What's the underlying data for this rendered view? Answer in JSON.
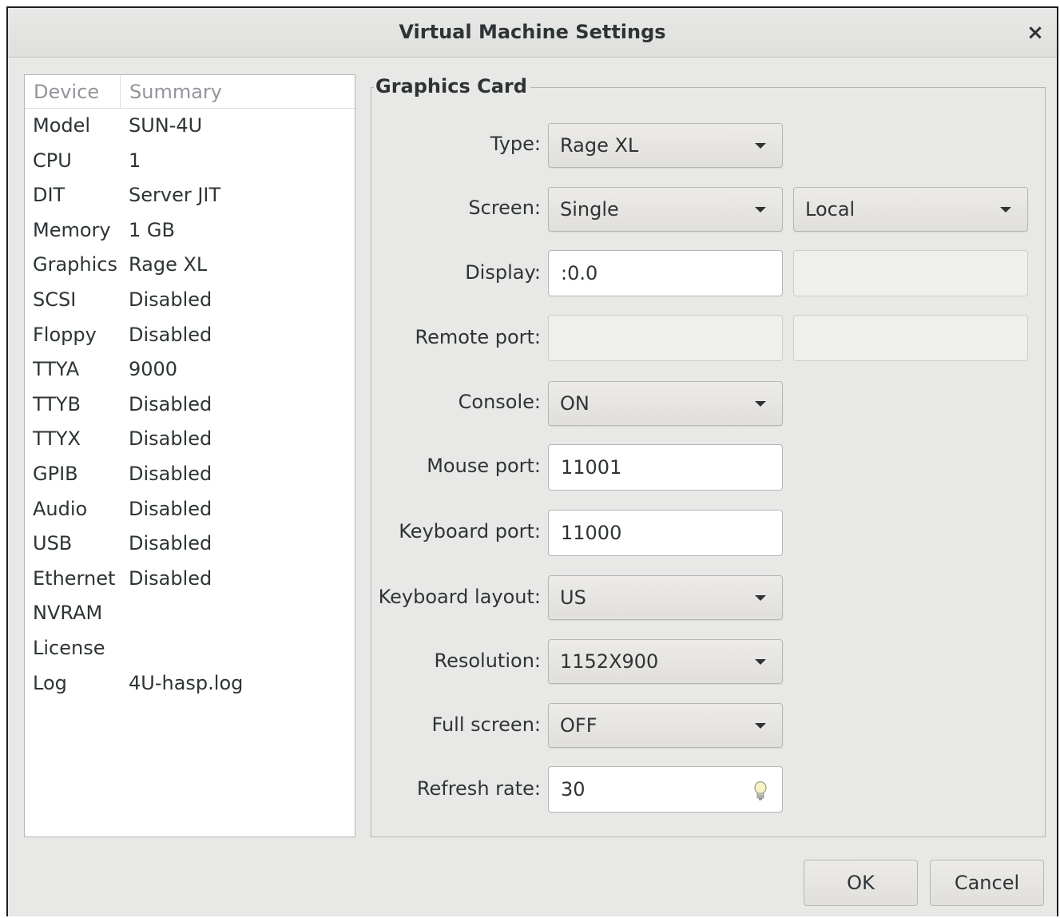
{
  "window": {
    "title": "Virtual Machine Settings",
    "close_glyph": "×"
  },
  "device_list": {
    "headers": {
      "device": "Device",
      "summary": "Summary"
    },
    "rows": [
      {
        "device": "Model",
        "summary": "SUN-4U"
      },
      {
        "device": "CPU",
        "summary": "1"
      },
      {
        "device": "DIT",
        "summary": "Server JIT"
      },
      {
        "device": "Memory",
        "summary": "1 GB"
      },
      {
        "device": "Graphics",
        "summary": "Rage XL"
      },
      {
        "device": "SCSI",
        "summary": "Disabled"
      },
      {
        "device": "Floppy",
        "summary": "Disabled"
      },
      {
        "device": "TTYA",
        "summary": "9000"
      },
      {
        "device": "TTYB",
        "summary": "Disabled"
      },
      {
        "device": "TTYX",
        "summary": "Disabled"
      },
      {
        "device": "GPIB",
        "summary": "Disabled"
      },
      {
        "device": "Audio",
        "summary": "Disabled"
      },
      {
        "device": "USB",
        "summary": "Disabled"
      },
      {
        "device": "Ethernet",
        "summary": "Disabled"
      },
      {
        "device": "NVRAM",
        "summary": ""
      },
      {
        "device": "License",
        "summary": ""
      },
      {
        "device": "Log",
        "summary": "4U-hasp.log"
      }
    ]
  },
  "graphics": {
    "frame_title": "Graphics Card",
    "type": {
      "label": "Type:",
      "value": "Rage XL"
    },
    "screen": {
      "label": "Screen:",
      "value": "Single",
      "secondary_value": "Local"
    },
    "display": {
      "label": "Display:",
      "value": ":0.0",
      "secondary_value": ""
    },
    "remote_port": {
      "label": "Remote port:",
      "value": "",
      "secondary_value": ""
    },
    "console": {
      "label": "Console:",
      "value": "ON"
    },
    "mouse_port": {
      "label": "Mouse port:",
      "value": "11001"
    },
    "keyboard_port": {
      "label": "Keyboard port:",
      "value": "11000"
    },
    "keyboard_layout": {
      "label": "Keyboard layout:",
      "value": "US"
    },
    "resolution": {
      "label": "Resolution:",
      "value": "1152X900"
    },
    "full_screen": {
      "label": "Full screen:",
      "value": "OFF"
    },
    "refresh_rate": {
      "label": "Refresh rate:",
      "value": "30",
      "icon": "lightbulb-icon"
    }
  },
  "buttons": {
    "ok": "OK",
    "cancel": "Cancel"
  }
}
